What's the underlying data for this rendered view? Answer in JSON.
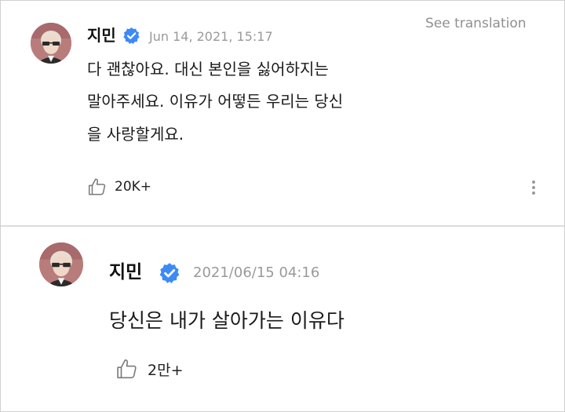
{
  "comments": [
    {
      "author": "지민",
      "timestamp": "Jun 14, 2021, 15:17",
      "translate_label": "See translation",
      "text_lines": [
        "다 괜찮아요. 대신 본인을 싫어하지는",
        "말아주세요. 이유가 어떻든 우리는 당신",
        "을 사랑할게요."
      ],
      "likes": "20K+",
      "verified_icon": "verified-check-icon",
      "like_icon": "thumbs-up-icon",
      "more_icon": "more-vertical-icon"
    },
    {
      "author": "지민",
      "timestamp": "2021/06/15 04:16",
      "text": "당신은 내가 살아가는 이유다",
      "likes": "2만+",
      "verified_icon": "verified-check-icon",
      "like_icon": "thumbs-up-icon"
    }
  ],
  "colors": {
    "verified": "#3d8af7",
    "timestamp": "#9a9a9a",
    "text": "#1a1a1a"
  }
}
